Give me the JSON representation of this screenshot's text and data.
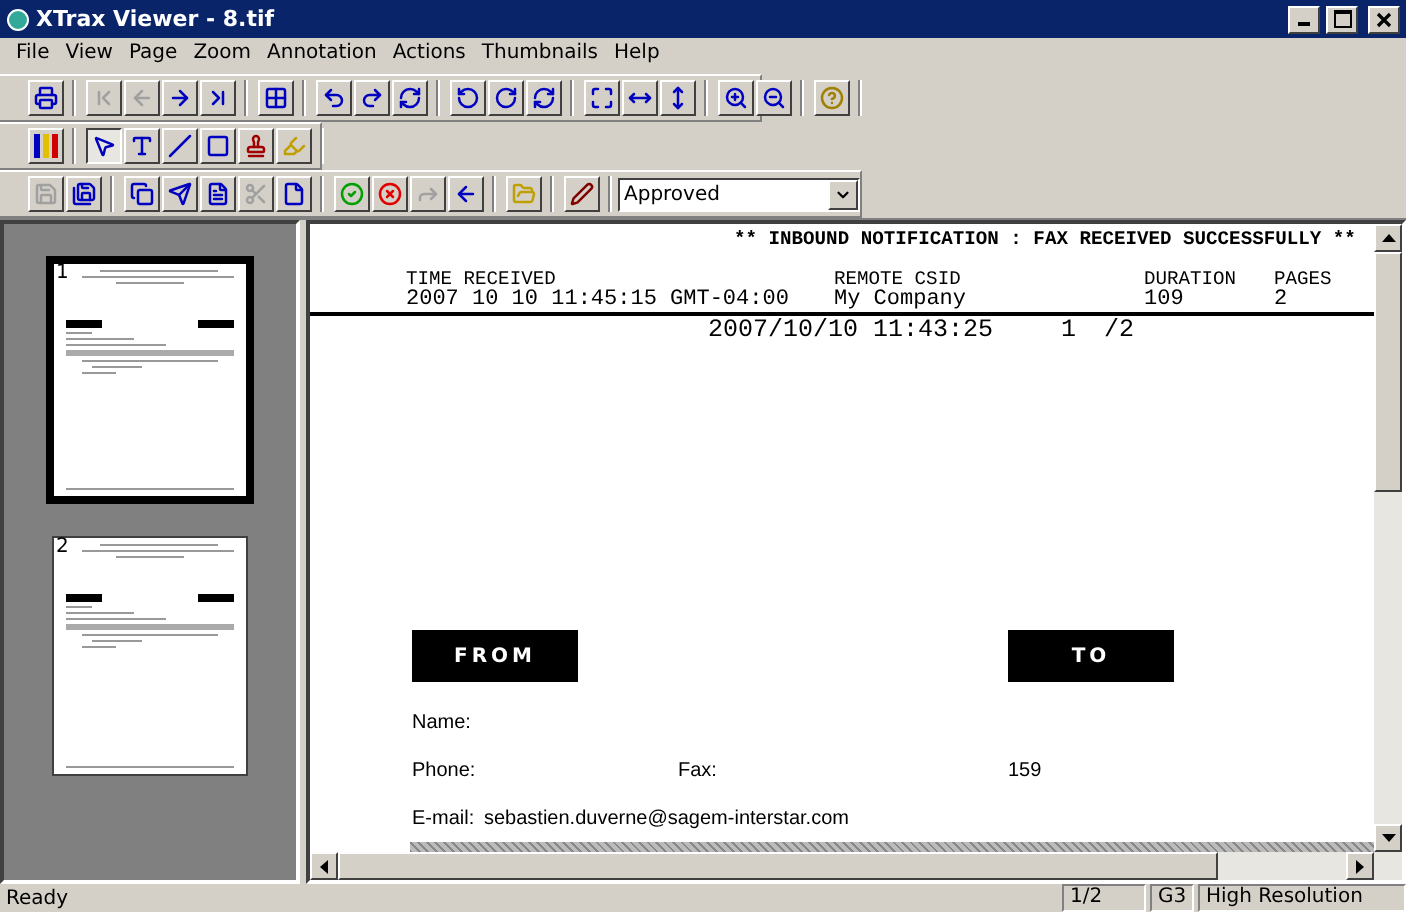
{
  "window": {
    "title": "XTrax Viewer - 8.tif"
  },
  "menu": [
    "File",
    "View",
    "Page",
    "Zoom",
    "Annotation",
    "Actions",
    "Thumbnails",
    "Help"
  ],
  "toolbars": [
    {
      "groups": [
        [
          {
            "disabled": false
          }
        ],
        [
          {
            "disabled": true
          },
          {
            "disabled": true
          },
          {
            "disabled": false
          },
          {
            "disabled": false
          }
        ],
        [
          {
            "disabled": false
          }
        ],
        [
          {
            "disabled": false
          },
          {
            "disabled": false
          },
          {
            "disabled": false
          }
        ],
        [
          {
            "disabled": false
          },
          {
            "disabled": false
          },
          {
            "disabled": false
          }
        ],
        [
          {
            "disabled": false
          },
          {
            "disabled": false
          },
          {
            "disabled": false
          }
        ],
        [
          {
            "disabled": false
          },
          {
            "disabled": false
          }
        ],
        [
          {
            "disabled": false
          }
        ]
      ]
    },
    {
      "groups": [
        [
          {
            "selected": false
          }
        ],
        [
          {
            "selected": true
          },
          {
            "selected": false
          },
          {
            "selected": false
          },
          {
            "selected": false
          },
          {
            "selected": false
          },
          {
            "selected": false
          }
        ]
      ]
    },
    {
      "groups": [
        [
          {
            "disabled": true
          },
          {
            "disabled": false
          }
        ],
        [
          {
            "disabled": false
          },
          {
            "disabled": false
          },
          {
            "disabled": false
          },
          {
            "disabled": true
          },
          {
            "disabled": false
          }
        ],
        [
          {
            "disabled": false
          },
          {
            "disabled": false
          },
          {
            "disabled": true
          },
          {
            "disabled": false
          }
        ],
        [
          {
            "disabled": false
          }
        ],
        [
          {
            "disabled": false
          }
        ]
      ]
    }
  ],
  "status_dropdown": {
    "value": "Approved"
  },
  "thumbnails": [
    {
      "number": "1",
      "selected": true
    },
    {
      "number": "2",
      "selected": false
    }
  ],
  "document": {
    "banner": "** INBOUND NOTIFICATION : FAX RECEIVED SUCCESSFULLY **",
    "columns": [
      {
        "heading": "TIME RECEIVED",
        "value": "2007 10 10 11:45:15 GMT-04:00"
      },
      {
        "heading": "REMOTE CSID",
        "value": "My Company"
      },
      {
        "heading": "DURATION",
        "value": "109"
      },
      {
        "heading": "PAGES",
        "value": "2"
      }
    ],
    "stamp": {
      "date": "2007/10/10 11:43:25",
      "page": "1",
      "total": "/2"
    },
    "from_label": "FROM",
    "to_label": "TO",
    "name_label": "Name:",
    "phone_label": "Phone:",
    "fax_label": "Fax:",
    "fax_to": "159",
    "email_label": "E-mail:",
    "email": "sebastien.duverne@sagem-interstar.com"
  },
  "status_bar": {
    "message": "Ready",
    "page": "1/2",
    "compression": "G3",
    "resolution": "High Resolution"
  }
}
